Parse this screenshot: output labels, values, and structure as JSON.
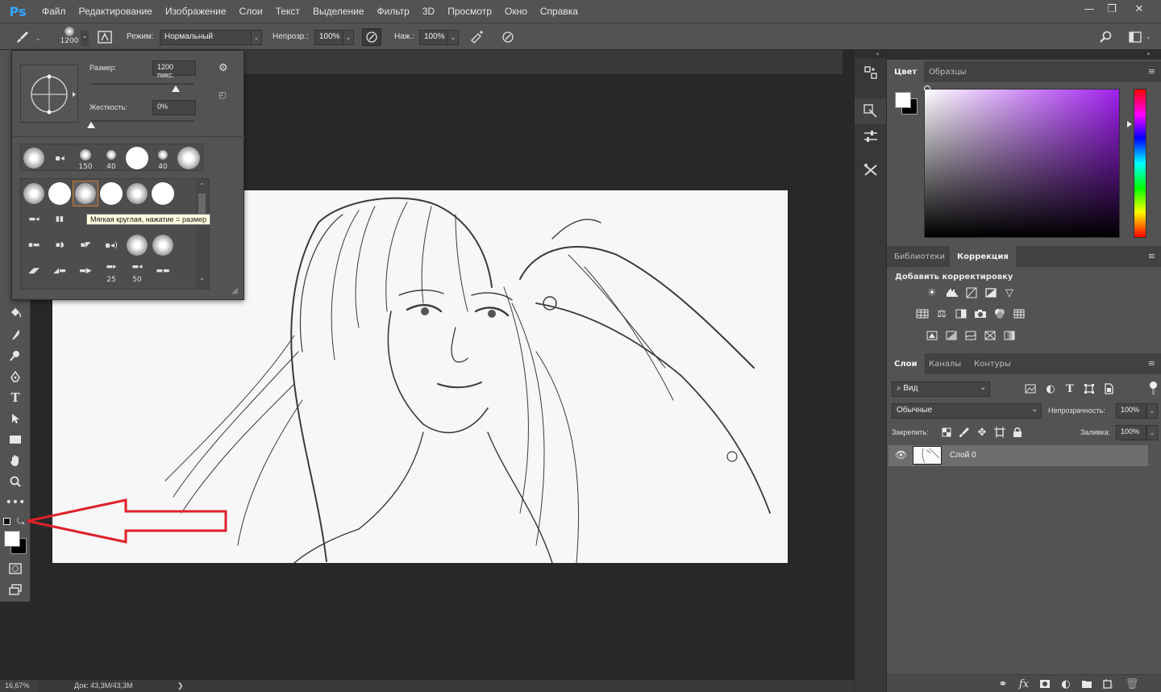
{
  "app": {
    "logo": "Ps"
  },
  "menu": [
    "Файл",
    "Редактирование",
    "Изображение",
    "Слои",
    "Текст",
    "Выделение",
    "Фильтр",
    "3D",
    "Просмотр",
    "Окно",
    "Справка"
  ],
  "window_buttons": {
    "minimize": "—",
    "restore": "❐",
    "close": "✕"
  },
  "options": {
    "brush_size": "1200",
    "mode_label": "Режим:",
    "mode_value": "Нормальный",
    "opacity_label": "Непрозр.:",
    "opacity_value": "100%",
    "pressure_label": "Наж.:",
    "pressure_value": "100%"
  },
  "brush_popup": {
    "size_label": "Размер:",
    "size_value": "1200 пикс.",
    "hardness_label": "Жесткость:",
    "hardness_value": "0%",
    "size_slider": 0.82,
    "hardness_slider": 0.0,
    "recent_numbers": [
      "150",
      "40",
      "40"
    ],
    "grid_numbers": [
      "25",
      "50"
    ],
    "tooltip": "Мягкая круглая, нажатие = размер"
  },
  "status": {
    "zoom": "16,67%",
    "doc": "Док: 43,3M/43,3M",
    "arrow": "❯"
  },
  "color_panel": {
    "tabs": [
      "Цвет",
      "Образцы"
    ],
    "active_tab": "Цвет",
    "hue_color": "#a020f0"
  },
  "adjust_panel": {
    "tabs": [
      "Библиотеки",
      "Коррекция"
    ],
    "active_tab": "Коррекция",
    "title": "Добавить корректировку"
  },
  "layers_panel": {
    "tabs": [
      "Слои",
      "Каналы",
      "Контуры"
    ],
    "active_tab": "Слои",
    "filter_label": "Вид",
    "blend_mode": "Обычные",
    "opacity_label": "Непрозрачность:",
    "opacity_value": "100%",
    "lock_label": "Закрепить:",
    "fill_label": "Заливка:",
    "fill_value": "100%",
    "layers": [
      {
        "name": "Слой 0",
        "visible": true
      }
    ]
  },
  "colors": {
    "accent_blue": "#31a8ff",
    "annotation_red": "#e0202a",
    "ui_gray": "#535353"
  }
}
